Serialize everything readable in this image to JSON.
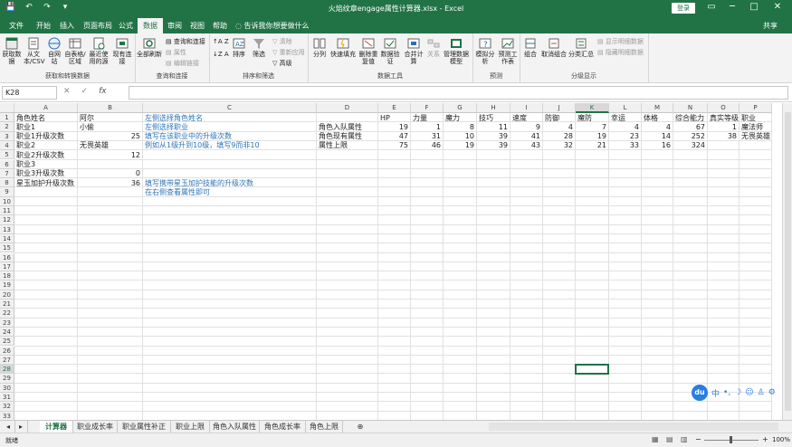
{
  "window": {
    "title": "火焰纹章engage属性计算器.xlsx - Excel",
    "login_label": "登录",
    "minimize": "▭",
    "restore": "─",
    "maximize": "□",
    "close": "✕"
  },
  "quick_access": {
    "save": "💾",
    "undo": "↶",
    "redo": "↷",
    "customize": "▾"
  },
  "menu": {
    "tabs": [
      "文件",
      "开始",
      "插入",
      "页面布局",
      "公式",
      "数据",
      "审阅",
      "视图",
      "帮助"
    ],
    "active_tab": "数据",
    "tell_me": "告诉我你想要做什么",
    "share": "共享"
  },
  "ribbon": {
    "get_data": "获取数据",
    "from_text_csv": "从文本/CSV",
    "from_web": "自网站",
    "from_table": "自表格/区域",
    "recent_sources": "最近使用的源",
    "existing_connections": "现有连接",
    "group_get_transform": "获取和转换数据",
    "refresh_all": "全部刷新",
    "queries_connections": "查询和连接",
    "properties": "属性",
    "edit_links": "编辑链接",
    "group_queries": "查询和连接",
    "sort_az": "↑A Z",
    "sort_za": "↓Z A",
    "sort": "排序",
    "filter": "筛选",
    "clear": "清除",
    "reapply": "重新应用",
    "advanced": "高级",
    "group_sort_filter": "排序和筛选",
    "text_to_columns": "分列",
    "flash_fill": "快速填充",
    "remove_duplicates": "删除重复值",
    "data_validation": "数据验证",
    "consolidate": "合并计算",
    "relationships": "关系",
    "manage_data_model": "管理数据模型",
    "group_data_tools": "数据工具",
    "what_if": "模拟分析",
    "forecast_sheet": "预测工作表",
    "group_forecast": "预测",
    "group": "组合",
    "ungroup": "取消组合",
    "subtotal": "分类汇总",
    "show_detail": "显示明细数据",
    "hide_detail": "隐藏明细数据",
    "group_outline": "分级显示"
  },
  "formula_bar": {
    "name_box": "K28",
    "cancel": "✕",
    "enter": "✓",
    "fx": "fx",
    "value": ""
  },
  "columns": [
    "A",
    "B",
    "C",
    "D",
    "E",
    "F",
    "G",
    "H",
    "I",
    "J",
    "K",
    "L",
    "M",
    "N",
    "O",
    "P"
  ],
  "rows": [
    "1",
    "2",
    "3",
    "4",
    "5",
    "6",
    "7",
    "8",
    "9",
    "10",
    "11",
    "12",
    "13",
    "14",
    "15",
    "16",
    "17",
    "18",
    "19",
    "20",
    "21",
    "22",
    "23",
    "24",
    "25",
    "26",
    "27",
    "28",
    "29",
    "30",
    "31",
    "32",
    "33"
  ],
  "selected": {
    "col": "K",
    "row": "28"
  },
  "cells": {
    "A1": "角色姓名",
    "B1": "阿尔",
    "C1": "左侧选择角色姓名",
    "D1": "",
    "E1": "HP",
    "F1": "力量",
    "G1": "魔力",
    "H1": "技巧",
    "I1": "速度",
    "J1": "防御",
    "K1": "魔防",
    "L1": "幸运",
    "M1": "体格",
    "N1": "综合能力",
    "O1": "真实等级",
    "P1": "职业",
    "A2": "职业1",
    "B2": "小偷",
    "C2": "左侧选择职业",
    "D2": "角色入队属性",
    "E2": "19",
    "F2": "1",
    "G2": "8",
    "H2": "11",
    "I2": "9",
    "J2": "4",
    "K2": "7",
    "L2": "4",
    "M2": "4",
    "N2": "67",
    "O2": "1",
    "P2": "魔法师",
    "A3": "职业1升级次数",
    "B3": "25",
    "C3": "填写在该职业中的升级次数",
    "D3": "角色现有属性",
    "E3": "47",
    "F3": "31",
    "G3": "10",
    "H3": "39",
    "I3": "41",
    "J3": "28",
    "K3": "19",
    "L3": "23",
    "M3": "14",
    "N3": "252",
    "O3": "38",
    "P3": "无畏英雄",
    "A4": "职业2",
    "B4": "无畏英雄",
    "C4": "例如从1级升到10级，填写9而非10",
    "D4": "属性上限",
    "E4": "75",
    "F4": "46",
    "G4": "19",
    "H4": "39",
    "I4": "43",
    "J4": "32",
    "K4": "21",
    "L4": "33",
    "M4": "16",
    "N4": "324",
    "A5": "职业2升级次数",
    "B5": "12",
    "A6": "职业3",
    "A7": "职业3升级次数",
    "B7": "0",
    "A8": "星玉加护升级次数",
    "B8": "36",
    "C8": "填写携带星玉加护技能的升级次数",
    "C9": "在右侧查看属性即可"
  },
  "sheet_tabs": [
    "计算器",
    "职业成长率",
    "职业属性补正",
    "职业上限",
    "角色入队属性",
    "角色成长率",
    "角色上限"
  ],
  "active_sheet": "计算器",
  "add_sheet": "⊕",
  "status": {
    "ready": "就绪",
    "zoom": "100%"
  },
  "floating_toolbar": {
    "logo": "du",
    "lang": "中",
    "punct": "•,",
    "moon": "☽",
    "emoji": "☺",
    "skin": "♙",
    "tools": "⚙"
  }
}
